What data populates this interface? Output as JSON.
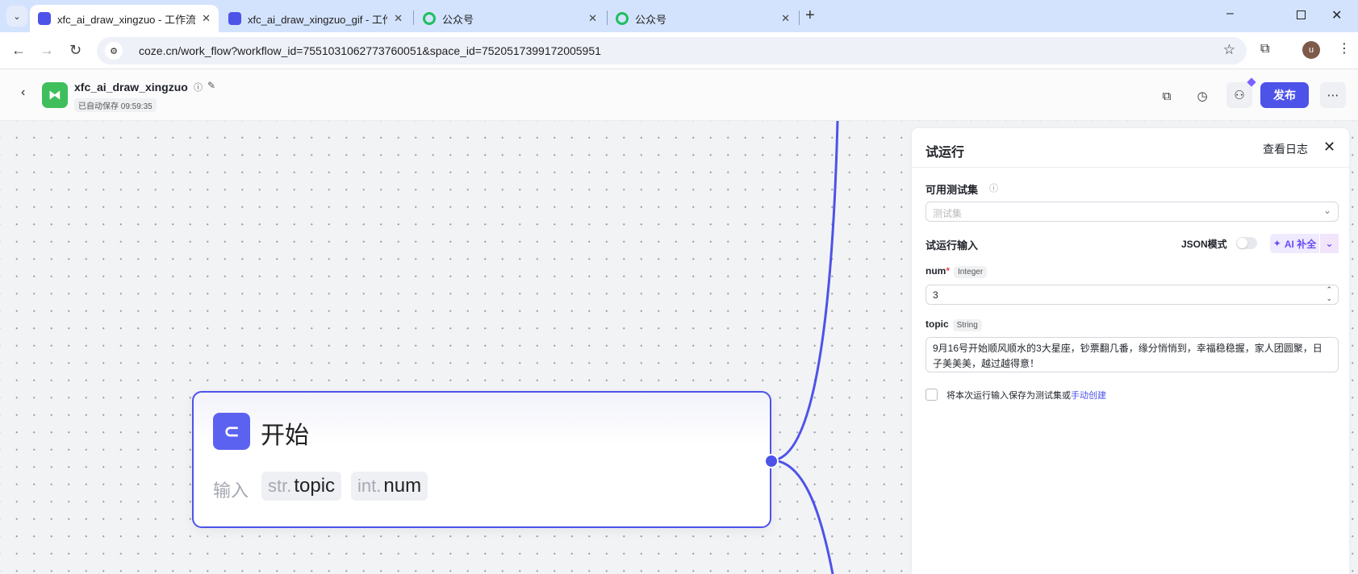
{
  "browser": {
    "tabs": [
      {
        "title": "xfc_ai_draw_xingzuo - 工作流",
        "icon": "coze-icon",
        "active": true
      },
      {
        "title": "xfc_ai_draw_xingzuo_gif - 工作流",
        "icon": "coze-icon",
        "active": false
      },
      {
        "title": "公众号",
        "icon": "wechat-mp-icon",
        "active": false
      },
      {
        "title": "公众号",
        "icon": "wechat-mp-icon",
        "active": false
      }
    ],
    "url": "coze.cn/work_flow?workflow_id=7551031062773760051&space_id=7520517399172005951",
    "avatar": "u"
  },
  "header": {
    "title": "xfc_ai_draw_xingzuo",
    "autosave": "已自动保存 09:59:35",
    "publish": "发布",
    "brand_color": "#4d53e8",
    "logo_color": "#3fbf5c"
  },
  "node": {
    "title": "开始",
    "input_label": "输入",
    "params": [
      {
        "type": "str.",
        "name": "topic"
      },
      {
        "type": "int.",
        "name": "num"
      }
    ]
  },
  "panel": {
    "title": "试运行",
    "view_logs": "查看日志",
    "testset_label": "可用测试集",
    "testset_placeholder": "测试集",
    "input_label": "试运行输入",
    "json_mode": "JSON模式",
    "json_mode_on": false,
    "ai_fill": "AI 补全",
    "fields": [
      {
        "name": "num",
        "required": true,
        "type": "Integer",
        "value": "3"
      },
      {
        "name": "topic",
        "required": false,
        "type": "String",
        "value": "9月16号开始顺风顺水的3大星座，钞票翻几番，缘分悄悄到，幸福稳稳握，家人团圆聚，日子美美美，越过越得意！"
      }
    ],
    "save_text": "将本次运行输入保存为测试集或",
    "save_link": "手动创建"
  }
}
